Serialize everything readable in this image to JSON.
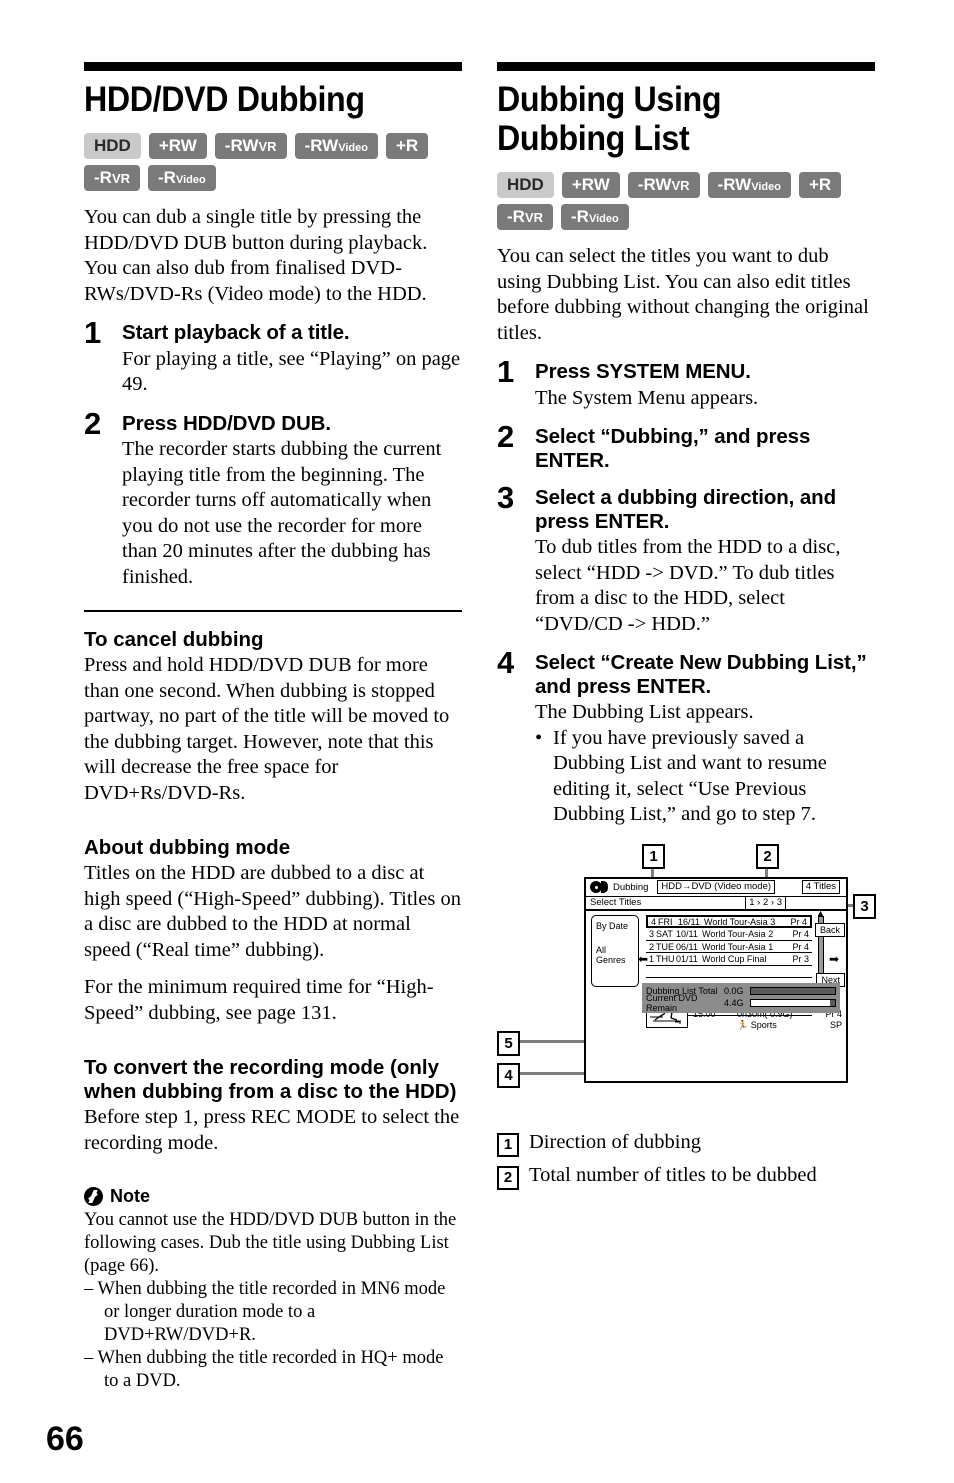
{
  "page_number": "66",
  "left": {
    "title": "HDD/DVD Dubbing",
    "badges": [
      [
        {
          "label": "HDD",
          "style": "light"
        },
        {
          "label": "+RW",
          "style": "dark"
        },
        {
          "label": "-RW",
          "sub": "VR",
          "style": "dark",
          "sub_size": "sm"
        },
        {
          "label": "-RW",
          "sub": "Video",
          "style": "dark"
        },
        {
          "label": "+R",
          "style": "dark"
        }
      ],
      [
        {
          "label": "-R",
          "sub": "VR",
          "style": "dark",
          "sub_size": "sm"
        },
        {
          "label": "-R",
          "sub": "Video",
          "style": "dark"
        }
      ]
    ],
    "intro": "You can dub a single title by pressing the HDD/DVD DUB button during playback. You can also dub from finalised DVD-RWs/DVD-Rs (Video mode) to the HDD.",
    "steps": [
      {
        "num": "1",
        "heading": "Start playback of a title.",
        "body": "For playing a title, see “Playing” on page 49."
      },
      {
        "num": "2",
        "heading": "Press HDD/DVD DUB.",
        "body": "The recorder starts dubbing the current playing title from the beginning. The recorder turns off automatically when you do not use the recorder for more than 20 minutes after the dubbing has finished."
      }
    ],
    "sections": [
      {
        "heading": "To cancel dubbing",
        "body": "Press and hold HDD/DVD DUB for more than one second. When dubbing is stopped partway, no part of the title will be moved to the dubbing target. However, note that this will decrease the free space for DVD+Rs/DVD-Rs."
      },
      {
        "heading": "About dubbing mode",
        "body": "Titles on the HDD are dubbed to a disc at high speed (“High-Speed” dubbing). Titles on a disc are dubbed to the HDD at normal speed (“Real time” dubbing).",
        "body2": "For the minimum required time for “High-Speed” dubbing, see page 131."
      },
      {
        "heading": "To convert the recording mode (only when dubbing from a disc to the HDD)",
        "body": "Before step 1, press REC MODE to select the recording mode."
      }
    ],
    "note": {
      "title": "Note",
      "body": "You cannot use the HDD/DVD DUB button in the following cases. Dub the title using Dubbing List (page 66).",
      "items": [
        "– When dubbing the title recorded in MN6 mode or longer duration mode to a DVD+RW/DVD+R.",
        "– When dubbing the title recorded in HQ+ mode to a DVD."
      ]
    }
  },
  "right": {
    "title": "Dubbing Using Dubbing List",
    "badges": [
      [
        {
          "label": "HDD",
          "style": "light"
        },
        {
          "label": "+RW",
          "style": "dark"
        },
        {
          "label": "-RW",
          "sub": "VR",
          "style": "dark",
          "sub_size": "sm"
        },
        {
          "label": "-RW",
          "sub": "Video",
          "style": "dark"
        },
        {
          "label": "+R",
          "style": "dark"
        }
      ],
      [
        {
          "label": "-R",
          "sub": "VR",
          "style": "dark",
          "sub_size": "sm"
        },
        {
          "label": "-R",
          "sub": "Video",
          "style": "dark"
        }
      ]
    ],
    "intro": "You can select the titles you want to dub using Dubbing List. You can also edit titles before dubbing without changing the original titles.",
    "steps": [
      {
        "num": "1",
        "heading": "Press SYSTEM MENU.",
        "body": "The System Menu appears."
      },
      {
        "num": "2",
        "heading": "Select “Dubbing,” and press ENTER.",
        "body": ""
      },
      {
        "num": "3",
        "heading": "Select a dubbing direction, and press ENTER.",
        "body": "To dub titles from the HDD to a disc, select “HDD -> DVD.” To dub titles from a disc to the HDD, select “DVD/CD -> HDD.”"
      },
      {
        "num": "4",
        "heading": "Select “Create New Dubbing List,” and press ENTER.",
        "body": "The Dubbing List appears.",
        "bullets": [
          "If you have previously saved a Dubbing List and want to resume editing it, select “Use Previous Dubbing List,” and go to step 7."
        ]
      }
    ],
    "diagram": {
      "callouts": {
        "c1": "1",
        "c2": "2",
        "c3": "3",
        "c4": "4",
        "c5": "5"
      },
      "screen": {
        "app_label": "Dubbing",
        "direction": "HDD→DVD (Video mode)",
        "title_count": "4 Titles",
        "sub_label": "Select Titles",
        "steps_indicator": "1 › 2 › 3",
        "side_panel": [
          "By Date",
          "All Genres"
        ],
        "rows": [
          {
            "num": "4",
            "day": "FRI",
            "date": "16/11",
            "title": "World Tour-Asia 3",
            "pr": "Pr 4",
            "selected": true
          },
          {
            "num": "3",
            "day": "SAT",
            "date": "10/11",
            "title": "World Tour-Asia 2",
            "pr": "Pr 4",
            "selected": false
          },
          {
            "num": "2",
            "day": "TUE",
            "date": "06/11",
            "title": "World Tour-Asia 1",
            "pr": "Pr 4",
            "selected": false
          },
          {
            "num": "1",
            "day": "THU",
            "date": "01/11",
            "title": "World Cup Final",
            "pr": "Pr 3",
            "selected": false
          }
        ],
        "back_button": "Back",
        "next_button": "Next",
        "info": {
          "title": "World Tour-Asia 3",
          "time": "15:00",
          "duration": "0h30m( 0.9G)",
          "pr": "Pr 4",
          "genre": "Sports",
          "mode": "SP"
        },
        "meters": [
          {
            "label": "Dubbing List Total",
            "value": "0.0G",
            "fill": 100
          },
          {
            "label": "Current DVD Remain",
            "value": "4.4G",
            "fill": 0
          }
        ]
      },
      "legend": [
        {
          "num": "1",
          "text": "Direction of dubbing"
        },
        {
          "num": "2",
          "text": "Total number of titles to be dubbed"
        }
      ]
    }
  }
}
